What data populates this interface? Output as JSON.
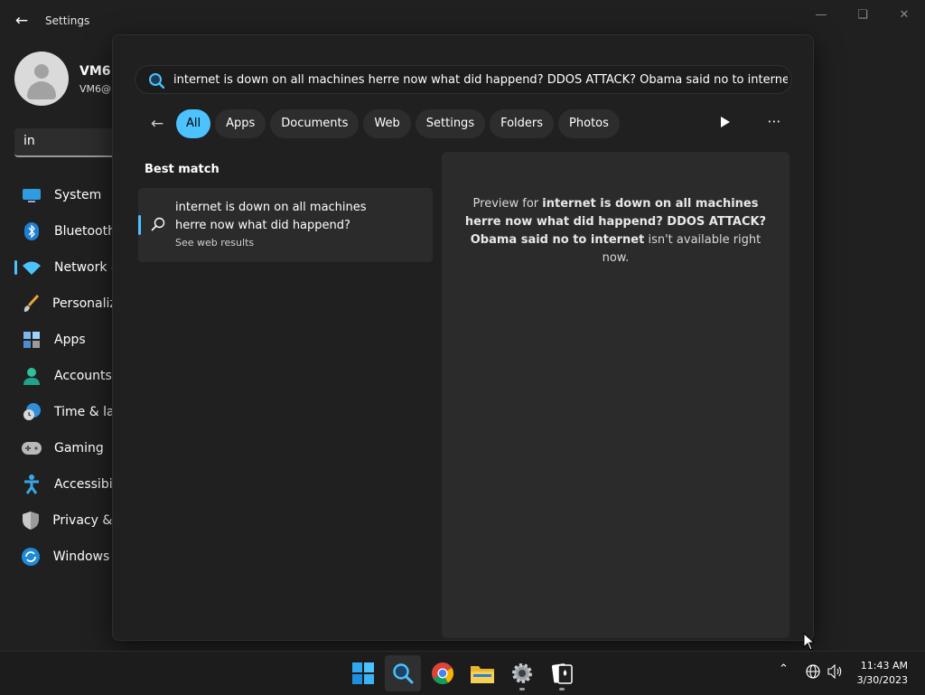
{
  "settings": {
    "app_title": "Settings",
    "profile": {
      "name": "VM6",
      "email": "VM6@"
    },
    "find_setting_value": "in",
    "nav": [
      {
        "label": "System",
        "icon": "system-icon"
      },
      {
        "label": "Bluetooth",
        "icon": "bluetooth-icon"
      },
      {
        "label": "Network &",
        "icon": "wifi-icon",
        "active": true
      },
      {
        "label": "Personaliza",
        "icon": "paintbrush-icon"
      },
      {
        "label": "Apps",
        "icon": "apps-icon"
      },
      {
        "label": "Accounts",
        "icon": "person-icon"
      },
      {
        "label": "Time & lar",
        "icon": "clock-globe-icon"
      },
      {
        "label": "Gaming",
        "icon": "gamepad-icon"
      },
      {
        "label": "Accessibili",
        "icon": "accessibility-icon"
      },
      {
        "label": "Privacy & s",
        "icon": "shield-icon"
      },
      {
        "label": "Windows U",
        "icon": "update-icon"
      }
    ]
  },
  "search": {
    "query": "internet is down on all machines herre now what did happend? DDOS ATTACK? Obama said no to internet",
    "filters": [
      "All",
      "Apps",
      "Documents",
      "Web",
      "Settings",
      "Folders",
      "Photos"
    ],
    "active_filter": "All",
    "best_match_heading": "Best match",
    "best_match": {
      "title": "internet is down on all machines herre now what did happend?",
      "subtitle": "See web results"
    },
    "preview": {
      "prefix": "Preview for ",
      "query_bold": "internet is down on all machines herre now what did happend? DDOS ATTACK? Obama said no to internet",
      "suffix": " isn't available right now."
    }
  },
  "taskbar": {
    "apps": [
      "start-icon",
      "search-icon",
      "chrome-icon",
      "file-explorer-icon",
      "settings-gear-icon",
      "solitaire-icon"
    ],
    "clock": {
      "time": "11:43 AM",
      "date": "3/30/2023"
    }
  },
  "colors": {
    "accent": "#4cc2ff",
    "background": "#202020",
    "surface": "#2b2b2b"
  }
}
